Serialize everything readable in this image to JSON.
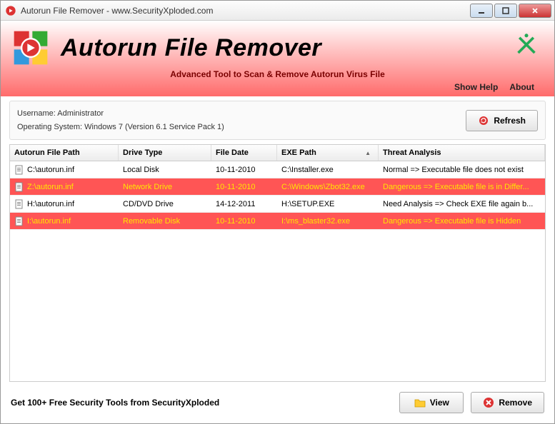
{
  "titlebar": {
    "text": "Autorun File Remover - www.SecurityXploded.com"
  },
  "header": {
    "app_title": "Autorun File Remover",
    "subtitle": "Advanced Tool to Scan & Remove Autorun Virus File"
  },
  "menu": {
    "show_help": "Show Help",
    "about": "About"
  },
  "info": {
    "username_label": "Username:",
    "username_value": "Administrator",
    "os_label": "Operating System:",
    "os_value": "Windows 7 (Version 6.1 Service Pack 1)"
  },
  "buttons": {
    "refresh": "Refresh",
    "view": "View",
    "remove": "Remove"
  },
  "table": {
    "headers": {
      "path": "Autorun File Path",
      "drive": "Drive Type",
      "date": "File Date",
      "exe": "EXE Path",
      "threat": "Threat Analysis"
    },
    "rows": [
      {
        "path": "C:\\autorun.inf",
        "drive": "Local Disk",
        "date": "10-11-2010",
        "exe": "C:\\Installer.exe",
        "threat": "Normal => Executable file does not exist",
        "danger": false
      },
      {
        "path": "Z:\\autorun.inf",
        "drive": "Network Drive",
        "date": "10-11-2010",
        "exe": "C:\\Windows\\Zbot32.exe",
        "threat": "Dangerous => Executable file is in Differ...",
        "danger": true
      },
      {
        "path": "H:\\autorun.inf",
        "drive": "CD/DVD Drive",
        "date": "14-12-2011",
        "exe": "H:\\SETUP.EXE",
        "threat": "Need Analysis => Check EXE file again b...",
        "danger": false
      },
      {
        "path": "I:\\autorun.inf",
        "drive": "Removable Disk",
        "date": "10-11-2010",
        "exe": "I:\\ms_blaster32.exe",
        "threat": "Dangerous => Executable file is Hidden",
        "danger": true
      }
    ]
  },
  "footer": {
    "text": "Get 100+ Free Security Tools from SecurityXploded"
  }
}
